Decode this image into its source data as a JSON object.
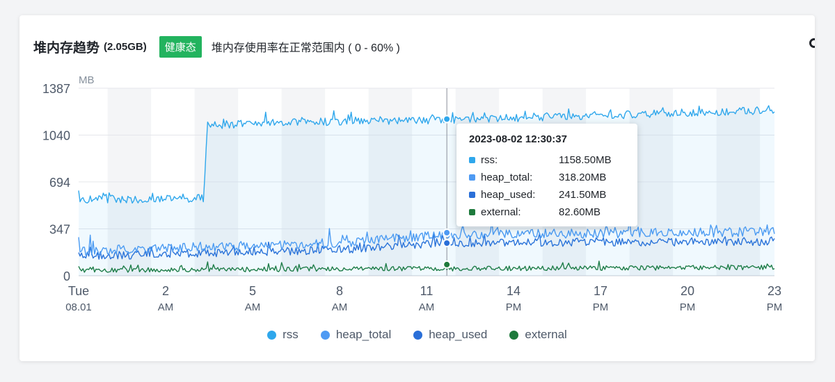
{
  "header": {
    "title": "堆内存趋势",
    "size": "(2.05GB)",
    "badge": "健康态",
    "description": "堆内存使用率在正常范围内 ( 0 - 60% )"
  },
  "colors": {
    "rss": "#2fa7ec",
    "heap_total": "#4e9af3",
    "heap_used": "#2a6fd8",
    "external": "#1e7a3c",
    "badge": "#22b35e"
  },
  "chart_data": {
    "type": "line",
    "y_unit": "MB",
    "ylim": [
      0,
      1387
    ],
    "yticks": [
      0,
      347,
      694,
      1040,
      1387
    ],
    "xlim": [
      0,
      24
    ],
    "xticks": [
      {
        "x": 0,
        "l1": "Tue",
        "l2": "08.01"
      },
      {
        "x": 3,
        "l1": "2",
        "l2": "AM"
      },
      {
        "x": 6,
        "l1": "5",
        "l2": "AM"
      },
      {
        "x": 9,
        "l1": "8",
        "l2": "AM"
      },
      {
        "x": 12,
        "l1": "11",
        "l2": "AM"
      },
      {
        "x": 15,
        "l1": "14",
        "l2": "PM"
      },
      {
        "x": 18,
        "l1": "17",
        "l2": "PM"
      },
      {
        "x": 21,
        "l1": "20",
        "l2": "PM"
      },
      {
        "x": 24,
        "l1": "23",
        "l2": "PM"
      }
    ],
    "grid": true,
    "legend_position": "bottom",
    "series": [
      {
        "name": "rss",
        "key": "rss",
        "levels": [
          [
            0,
            560
          ],
          [
            4.3,
            570
          ],
          [
            4.45,
            1110
          ],
          [
            9,
            1140
          ],
          [
            12.5,
            1150
          ],
          [
            24,
            1220
          ]
        ],
        "noise": 60
      },
      {
        "name": "heap_total",
        "key": "heap_total",
        "levels": [
          [
            0,
            180
          ],
          [
            9,
            240
          ],
          [
            12.7,
            300
          ],
          [
            24,
            320
          ]
        ],
        "noise": 70
      },
      {
        "name": "heap_used",
        "key": "heap_used",
        "levels": [
          [
            0,
            140
          ],
          [
            9,
            190
          ],
          [
            12.7,
            240
          ],
          [
            24,
            250
          ]
        ],
        "noise": 60
      },
      {
        "name": "external",
        "key": "external",
        "levels": [
          [
            0,
            40
          ],
          [
            24,
            60
          ]
        ],
        "noise": 35
      }
    ],
    "cursor": {
      "x": 12.7
    },
    "tooltip": {
      "title": "2023-08-02 12:30:37",
      "rows": [
        {
          "name": "rss:",
          "value": "1158.50MB",
          "key": "rss",
          "y": 1158.5
        },
        {
          "name": "heap_total:",
          "value": "318.20MB",
          "key": "heap_total",
          "y": 318.2
        },
        {
          "name": "heap_used:",
          "value": "241.50MB",
          "key": "heap_used",
          "y": 241.5
        },
        {
          "name": "external:",
          "value": "82.60MB",
          "key": "external",
          "y": 82.6
        }
      ]
    },
    "legend": [
      {
        "name": "rss",
        "key": "rss"
      },
      {
        "name": "heap_total",
        "key": "heap_total"
      },
      {
        "name": "heap_used",
        "key": "heap_used"
      },
      {
        "name": "external",
        "key": "external"
      }
    ]
  }
}
